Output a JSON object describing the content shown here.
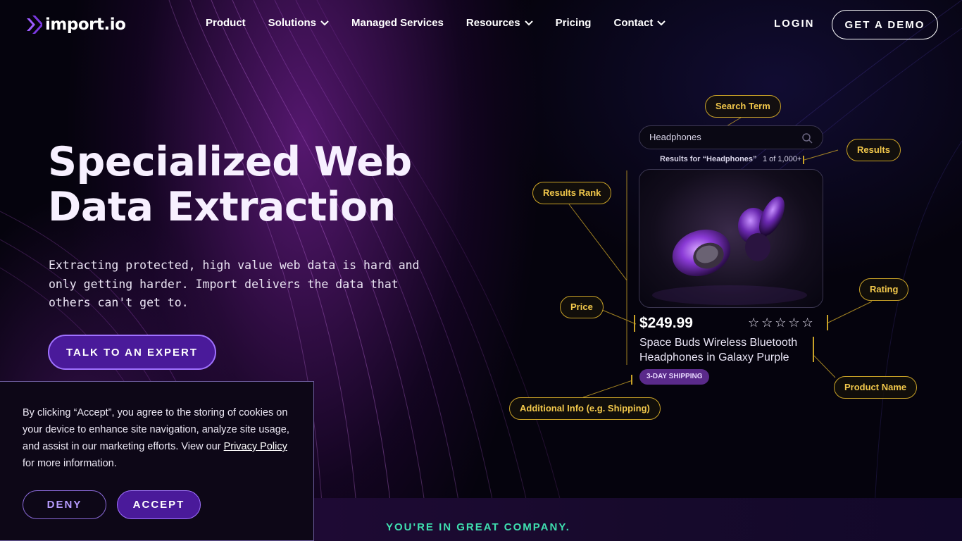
{
  "brand": {
    "logo_text": "import.io",
    "accent_color": "#4a1a9a",
    "highlight_color": "#f2c84b",
    "teal_color": "#3fe0b0"
  },
  "nav": {
    "items": [
      {
        "label": "Product",
        "has_dropdown": false
      },
      {
        "label": "Solutions",
        "has_dropdown": true
      },
      {
        "label": "Managed Services",
        "has_dropdown": false
      },
      {
        "label": "Resources",
        "has_dropdown": true
      },
      {
        "label": "Pricing",
        "has_dropdown": false
      },
      {
        "label": "Contact",
        "has_dropdown": true
      }
    ],
    "login_label": "LOGIN",
    "demo_label": "GET A DEMO"
  },
  "hero": {
    "title_line1": "Specialized Web",
    "title_line2": "Data Extraction",
    "subtitle": "Extracting protected, high value web data is hard and only getting harder. Import delivers the data that others can't get to.",
    "cta_label": "TALK TO AN EXPERT"
  },
  "illustration": {
    "tags": {
      "search_term": "Search Term",
      "results": "Results",
      "results_rank": "Results Rank",
      "price": "Price",
      "rating": "Rating",
      "product_name": "Product Name",
      "additional_info": "Additional Info (e.g. Shipping)"
    },
    "search_value": "Headphones",
    "results_text": "Results for “Headphones”",
    "results_count": "1 of 1,000+",
    "price": "$249.99",
    "rating_stars": "☆☆☆☆☆",
    "product_name": "Space Buds Wireless Bluetooth Headphones in Galaxy Purple",
    "shipping_badge": "3-DAY SHIPPING"
  },
  "cookie": {
    "text_before_link": "By clicking “Accept”, you agree to the storing of cookies on your device to enhance site navigation, analyze site usage, and assist in our marketing efforts. View our ",
    "link_text": "Privacy Policy",
    "text_after_link": " for more information.",
    "deny_label": "DENY",
    "accept_label": "ACCEPT"
  },
  "trust": {
    "label": "YOU'RE IN GREAT COMPANY."
  }
}
